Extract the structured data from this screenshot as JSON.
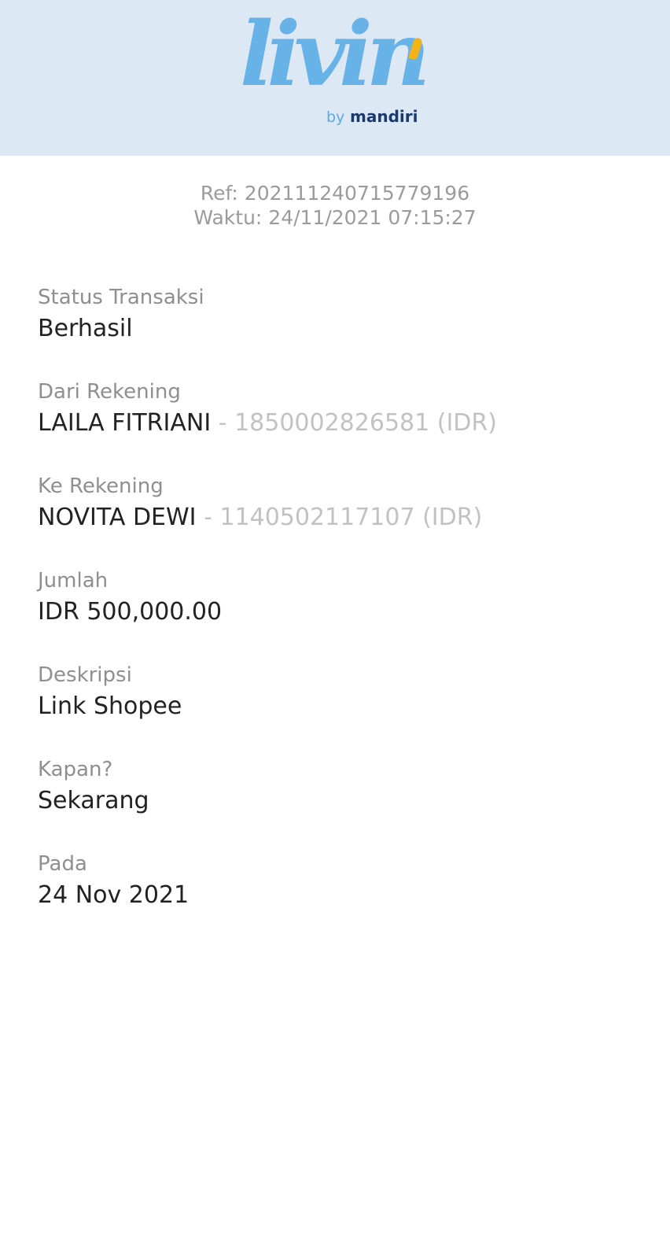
{
  "brand": {
    "logo_script": "livin",
    "logo_by": "by",
    "logo_mandiri": "mandiri"
  },
  "receipt": {
    "ref": "Ref: 202111240715779196",
    "time": "Waktu: 24/11/2021 07:15:27"
  },
  "fields": {
    "status": {
      "label": "Status Transaksi",
      "value": "Berhasil"
    },
    "from": {
      "label": "Dari Rekening",
      "name": "LAILA FITRIANI",
      "account": " - 1850002826581 (IDR)"
    },
    "to": {
      "label": "Ke Rekening",
      "name": "NOVITA DEWI",
      "account": " - 1140502117107 (IDR)"
    },
    "amount": {
      "label": "Jumlah",
      "value": "IDR 500,000.00"
    },
    "description": {
      "label": "Deskripsi",
      "value": "Link Shopee"
    },
    "when": {
      "label": "Kapan?",
      "value": "Sekarang"
    },
    "on": {
      "label": "Pada",
      "value": "24 Nov 2021"
    }
  },
  "colors": {
    "header_bg": "#dce8f4",
    "logo_blue": "#67b2e6",
    "logo_accent": "#f2b418",
    "mandiri_navy": "#1a3a6e"
  }
}
